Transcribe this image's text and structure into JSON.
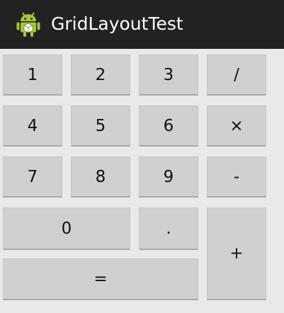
{
  "app": {
    "title": "GridLayoutTest",
    "icon": "android-robot-icon",
    "colors": {
      "action_bar": "#222222",
      "background": "#e9e9e9",
      "button": "#d0d0d0",
      "robot": "#a4c639"
    }
  },
  "keys": {
    "k1": "1",
    "k2": "2",
    "k3": "3",
    "div": "/",
    "k4": "4",
    "k5": "5",
    "k6": "6",
    "mul": "×",
    "k7": "7",
    "k8": "8",
    "k9": "9",
    "sub": "-",
    "k0": "0",
    "dot": ".",
    "add": "+",
    "eq": "="
  }
}
